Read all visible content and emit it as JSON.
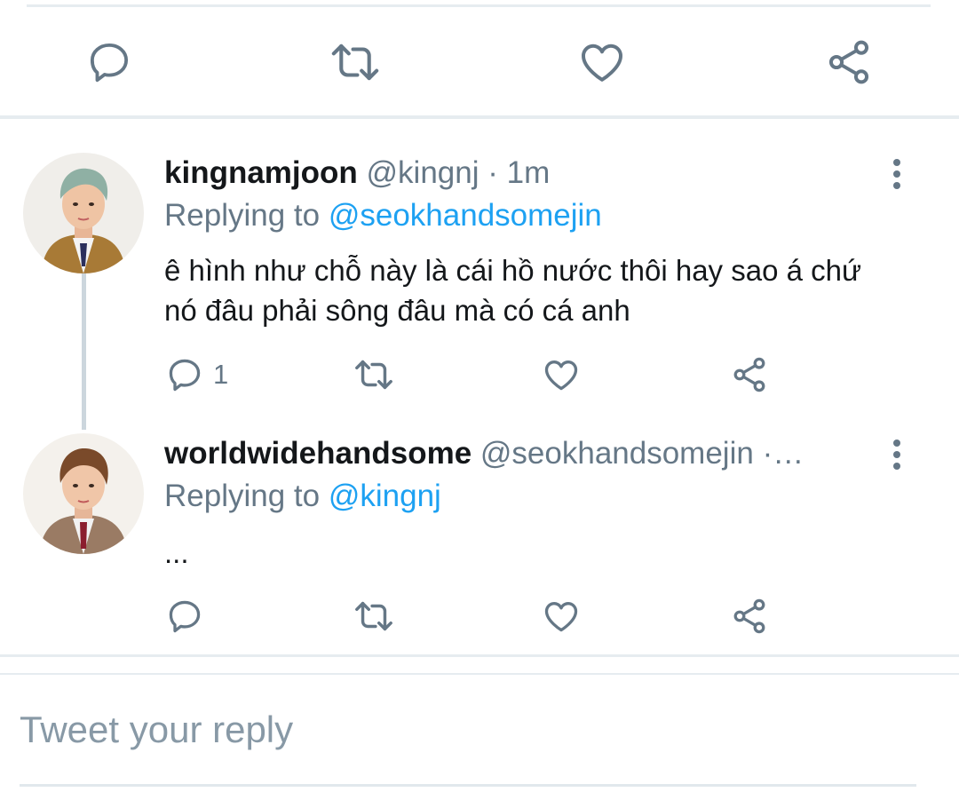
{
  "colors": {
    "accent": "#1da1f2",
    "icon": "#657786",
    "divider": "#e6ecf0",
    "text": "#14171a",
    "secondary_text": "#657786"
  },
  "top_actions": {
    "icons": [
      "reply-icon",
      "retweet-icon",
      "like-icon",
      "share-icon"
    ]
  },
  "tweets": [
    {
      "display_name": "kingnamjoon",
      "handle": "@kingnj",
      "separator": "·",
      "time": "1m",
      "replying_prefix": "Replying to",
      "replying_to": "@seokhandsomejin",
      "text": "ê hình như chỗ này là cái hồ nước thôi hay sao á chứ nó đâu phải sông đâu mà có cá anh",
      "reply_count": "1"
    },
    {
      "display_name": "worldwidehandsome",
      "handle": "@seokhandsomejin",
      "separator": "·…",
      "replying_prefix": "Replying to",
      "replying_to": "@kingnj",
      "text": "..."
    }
  ],
  "compose": {
    "placeholder": "Tweet your reply"
  }
}
